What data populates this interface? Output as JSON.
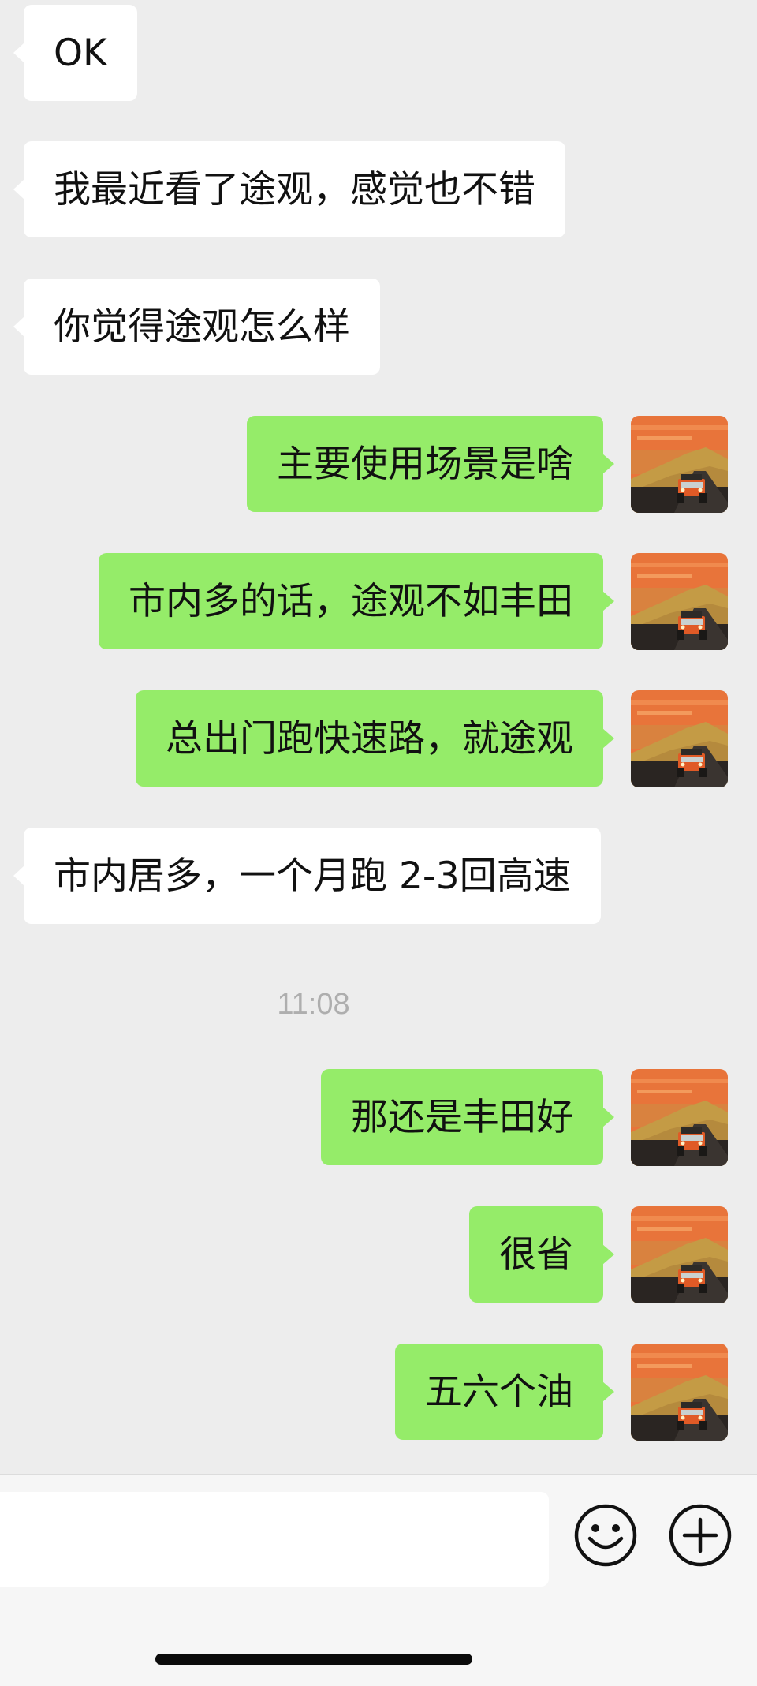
{
  "messages": [
    {
      "side": "left",
      "text": "OK"
    },
    {
      "side": "left",
      "text": "我最近看了途观，感觉也不错"
    },
    {
      "side": "left",
      "text": "你觉得途观怎么样"
    },
    {
      "side": "right",
      "text": "主要使用场景是啥"
    },
    {
      "side": "right",
      "text": "市内多的话，途观不如丰田"
    },
    {
      "side": "right",
      "text": "总出门跑快速路，就途观"
    },
    {
      "side": "left",
      "text": "市内居多，一个月跑 2-3回高速"
    },
    {
      "side": "right",
      "text": "那还是丰田好"
    },
    {
      "side": "right",
      "text": "很省"
    },
    {
      "side": "right",
      "text": "五六个油"
    }
  ],
  "timestamp": "11:08",
  "colors": {
    "background": "#ededed",
    "incoming_bubble": "#ffffff",
    "outgoing_bubble": "#95ec69",
    "timestamp_text": "#aeaeae"
  },
  "input": {
    "value": "",
    "placeholder": ""
  },
  "icons": {
    "emoji": "smiley-face-icon",
    "more": "plus-circle-icon",
    "avatar": "orange-jeep-sunset-avatar"
  }
}
